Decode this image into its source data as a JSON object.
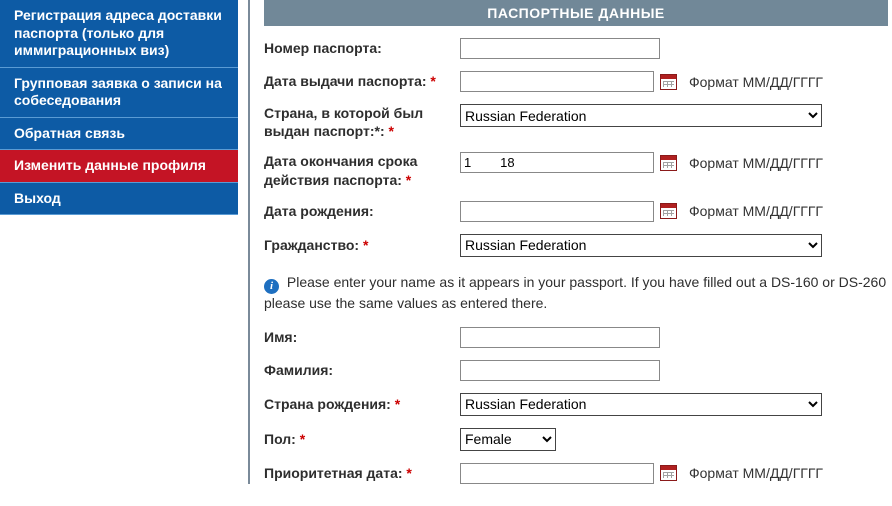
{
  "sidebar": {
    "items": [
      {
        "label": "Регистрация адреса доставки паспорта (только для иммиграционных виз)"
      },
      {
        "label": "Групповая заявка о записи на собеседования"
      },
      {
        "label": "Обратная связь"
      },
      {
        "label": "Изменить данные профиля"
      },
      {
        "label": "Выход"
      }
    ]
  },
  "panel": {
    "title": "ПАСПОРТНЫЕ ДАННЫЕ"
  },
  "hints": {
    "date_format": "Формат ММ/ДД/ГГГГ"
  },
  "info": {
    "text": "Please enter your name as it appears in your passport. If you have filled out a DS-160 or DS-260 please use the same values as entered there."
  },
  "countries": [
    "Russian Federation"
  ],
  "genders": [
    "Female"
  ],
  "fields": {
    "passport_number": {
      "label": "Номер паспорта:",
      "value": ""
    },
    "issue_date": {
      "label": "Дата выдачи паспорта:",
      "required": true,
      "value": ""
    },
    "issue_country": {
      "label": "Страна, в которой был выдан паспорт:*:",
      "required": true,
      "value": "Russian Federation"
    },
    "expiry_date": {
      "label": "Дата окончания срока действия паспорта:",
      "required": true,
      "value": "1        18"
    },
    "birth_date": {
      "label": "Дата рождения:",
      "value": ""
    },
    "citizenship": {
      "label": "Гражданство:",
      "required": true,
      "value": "Russian Federation"
    },
    "first_name": {
      "label": "Имя:",
      "value": ""
    },
    "last_name": {
      "label": "Фамилия:",
      "value": ""
    },
    "birth_country": {
      "label": "Страна рождения:",
      "required": true,
      "value": "Russian Federation"
    },
    "gender": {
      "label": "Пол:",
      "required": true,
      "value": "Female"
    },
    "priority_date": {
      "label": "Приоритетная дата:",
      "required": true,
      "value": ""
    }
  }
}
